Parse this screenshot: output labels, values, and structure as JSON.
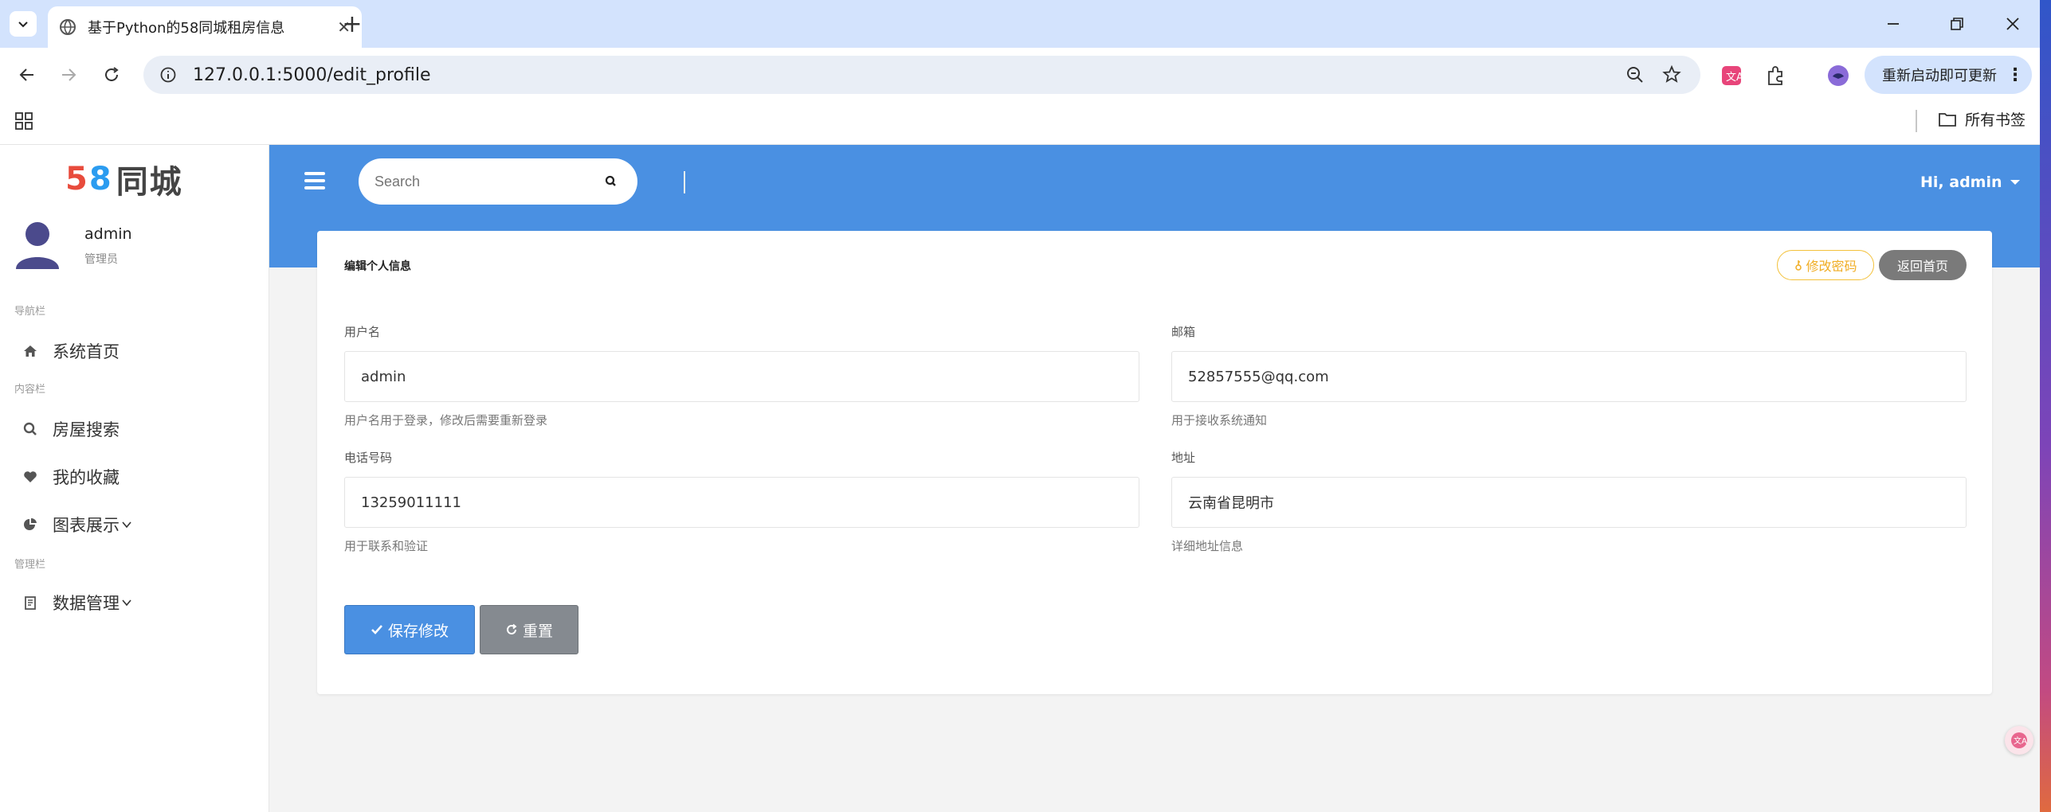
{
  "browser": {
    "tab_title": "基于Python的58同城租房信息",
    "url": "127.0.0.1:5000/edit_profile",
    "update_label": "重新启动即可更新",
    "all_bookmarks": "所有书签"
  },
  "sidebar": {
    "logo_digit_5": "5",
    "logo_digit_8": "8",
    "logo_text": "同城",
    "user_name": "admin",
    "user_role": "管理员",
    "sections": {
      "nav": "导航栏",
      "content": "内容栏",
      "admin": "管理栏"
    },
    "items": [
      {
        "label": "系统首页",
        "icon": "home-icon"
      },
      {
        "label": "房屋搜索",
        "icon": "search-icon"
      },
      {
        "label": "我的收藏",
        "icon": "heart-icon"
      },
      {
        "label": "图表展示",
        "icon": "pie-chart-icon"
      },
      {
        "label": "数据管理",
        "icon": "clipboard-icon"
      }
    ]
  },
  "topbar": {
    "search_placeholder": "Search",
    "greeting": "Hi, admin"
  },
  "card": {
    "title": "编辑个人信息",
    "change_password_label": "修改密码",
    "back_home_label": "返回首页",
    "fields": {
      "username": {
        "label": "用户名",
        "value": "admin",
        "hint": "用户名用于登录，修改后需要重新登录"
      },
      "email": {
        "label": "邮箱",
        "value": "52857555@qq.com",
        "hint": "用于接收系统通知"
      },
      "phone": {
        "label": "电话号码",
        "value": "13259011111",
        "hint": "用于联系和验证"
      },
      "address": {
        "label": "地址",
        "value": "云南省昆明市",
        "hint": "详细地址信息"
      }
    },
    "save_label": "保存修改",
    "reset_label": "重置"
  },
  "colors": {
    "primary": "#4a90e2",
    "warning": "#f0ad24",
    "secondary": "#858a90"
  }
}
